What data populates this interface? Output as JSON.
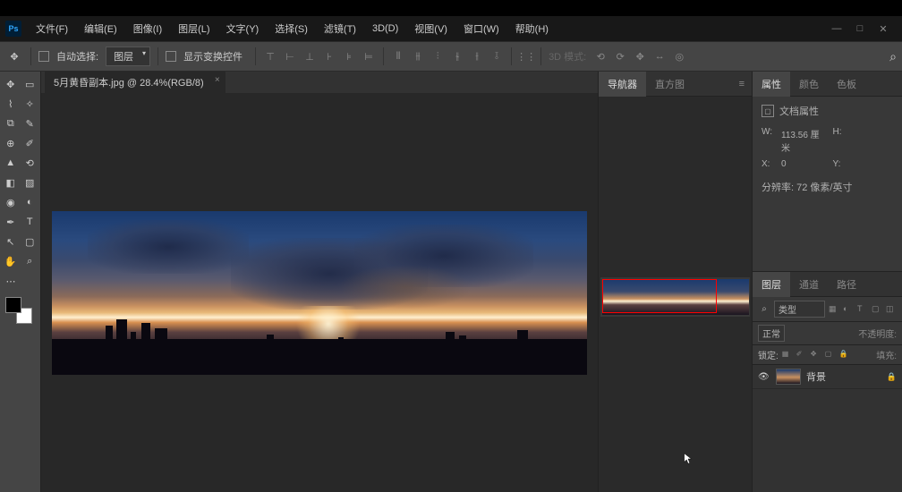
{
  "menu": {
    "file": "文件(F)",
    "edit": "编辑(E)",
    "image": "图像(I)",
    "layer": "图层(L)",
    "type": "文字(Y)",
    "select": "选择(S)",
    "filter": "滤镜(T)",
    "threed": "3D(D)",
    "view": "视图(V)",
    "window": "窗口(W)",
    "help": "帮助(H)"
  },
  "options": {
    "auto_select": "自动选择:",
    "target": "图层",
    "show_transform": "显示变换控件",
    "mode3d_label": "3D 模式:"
  },
  "document": {
    "tab_title": "5月黄昏副本.jpg @ 28.4%(RGB/8)"
  },
  "navigator": {
    "tab_nav": "导航器",
    "tab_histogram": "直方图"
  },
  "properties": {
    "tab_props": "属性",
    "tab_color": "颜色",
    "tab_swatches": "色板",
    "doc_props": "文档属性",
    "w_label": "W:",
    "w_value": "113.56 厘米",
    "h_label": "H:",
    "x_label": "X:",
    "x_value": "0",
    "y_label": "Y:",
    "resolution": "分辨率: 72 像素/英寸"
  },
  "layers": {
    "tab_layers": "图层",
    "tab_channels": "通道",
    "tab_paths": "路径",
    "filter_type": "类型",
    "blend_mode": "正常",
    "opacity_label": "不透明度:",
    "lock_label": "锁定:",
    "fill_label": "填充:",
    "bg_layer": "背景"
  }
}
